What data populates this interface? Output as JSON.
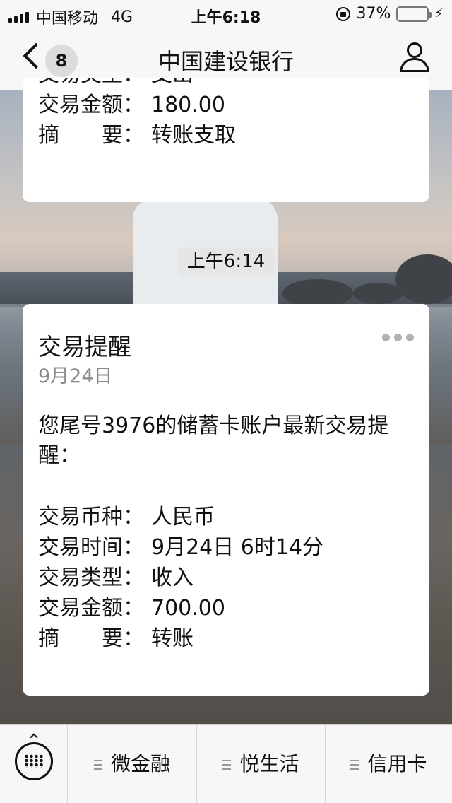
{
  "status_bar": {
    "carrier": "中国移动",
    "network": "4G",
    "time": "上午6:18",
    "battery_percent": "37%",
    "battery_level": 0.37,
    "icons": [
      "signal-icon",
      "rotation-lock-icon",
      "battery-icon",
      "charging-icon"
    ]
  },
  "nav": {
    "back_badge": "8",
    "title": "中国建设银行",
    "icons": [
      "back-chevron-icon",
      "person-icon"
    ]
  },
  "messages": {
    "previous": {
      "rows": [
        {
          "key": "交易类型：",
          "value": "支出"
        },
        {
          "key": "交易金额：",
          "value": "180.00"
        },
        {
          "key": "摘　　要：",
          "value": "转账支取"
        }
      ]
    },
    "timestamp": "上午6:14",
    "current": {
      "title": "交易提醒",
      "date": "9月24日",
      "intro": "您尾号3976的储蓄卡账户最新交易提醒：",
      "rows": [
        {
          "key": "交易币种：",
          "value": "人民币"
        },
        {
          "key": "交易时间：",
          "value": "9月24日 6时14分"
        },
        {
          "key": "交易类型：",
          "value": "收入"
        },
        {
          "key": "交易金额：",
          "value": "700.00"
        },
        {
          "key": "摘　　要：",
          "value": "转账"
        }
      ]
    }
  },
  "bottom_bar": {
    "menu": [
      {
        "label": "微金融"
      },
      {
        "label": "悦生活"
      },
      {
        "label": "信用卡"
      }
    ],
    "icons": [
      "keyboard-icon",
      "menu-lines-icon"
    ]
  },
  "colors": {
    "bar_bg": "#f7f7f7",
    "card_bg": "#ffffff",
    "date_gray": "#8a8a8a",
    "battery_green": "#4cd964"
  }
}
